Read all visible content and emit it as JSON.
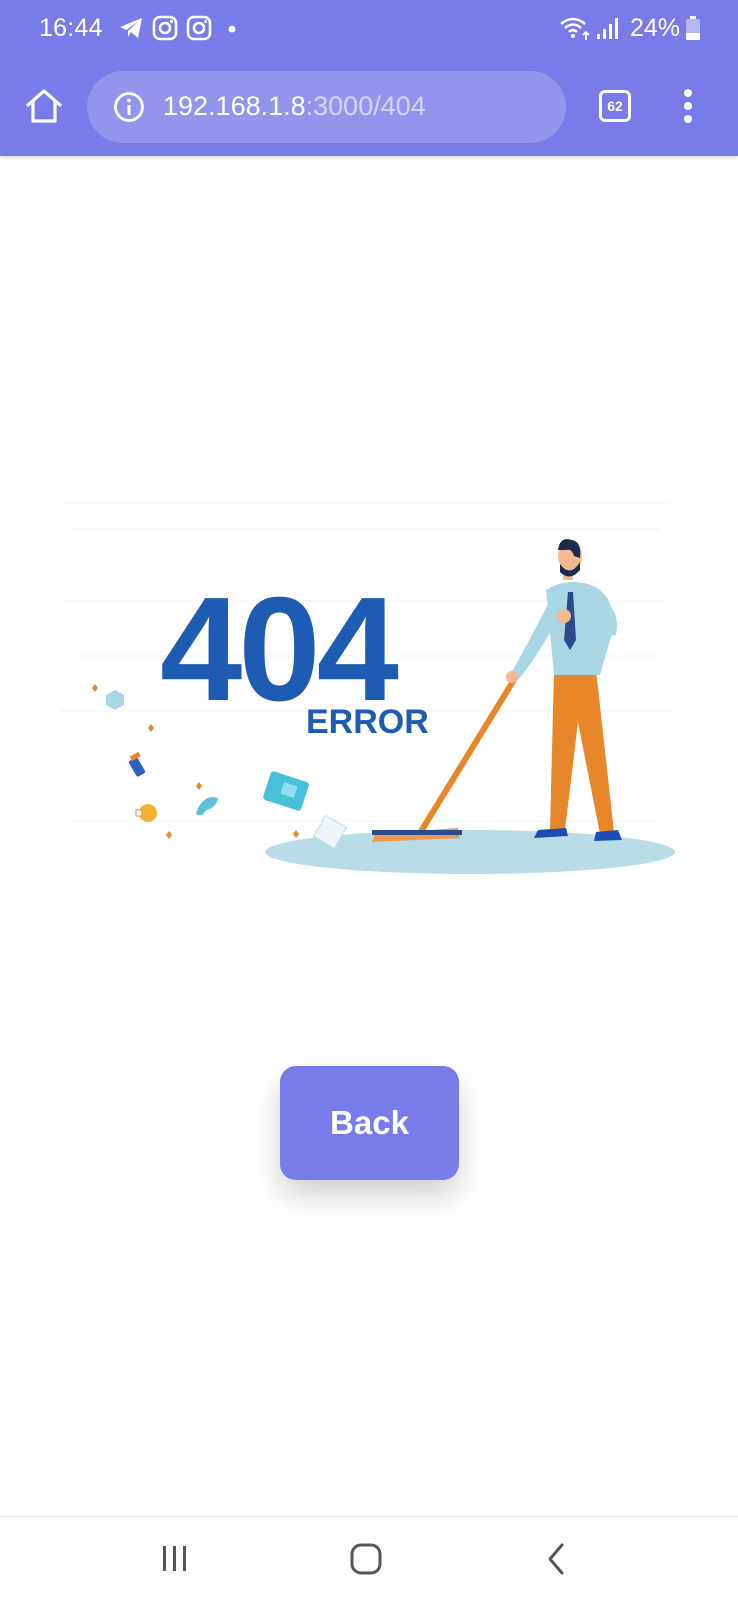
{
  "status_bar": {
    "time": "16:44",
    "battery": "24%",
    "icons": [
      "telegram-icon",
      "instagram-icon",
      "instagram-icon",
      "dot-icon",
      "wifi-icon",
      "signal-icon",
      "battery-icon"
    ]
  },
  "browser": {
    "url_host": "192.168.1.8",
    "url_path": ":3000/404",
    "tab_count": "62",
    "toolbar_color": "#787BE8"
  },
  "content": {
    "error_code": "404",
    "error_word": "ERROR",
    "back_label": "Back",
    "accent_color": "#787BE8",
    "error_color": "#1E5CB3"
  },
  "nav_bar": {
    "buttons": [
      "recent-apps-icon",
      "home-icon",
      "back-icon"
    ]
  }
}
